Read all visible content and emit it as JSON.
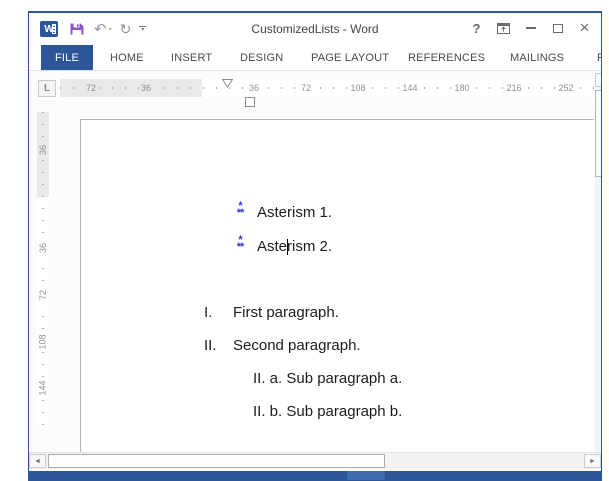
{
  "window": {
    "title": "CustomizedLists - Word",
    "controls": {
      "help_glyph": "?",
      "close_glyph": "×"
    }
  },
  "quick_access": {
    "word_logo_letter": "W",
    "undo_glyph": "↶",
    "undo_dropdown_glyph": "▾",
    "redo_glyph": "↻",
    "more_chevron_glyph": "▾"
  },
  "ribbon": {
    "tabs": [
      {
        "label": "FILE",
        "active": true
      },
      {
        "label": "HOME"
      },
      {
        "label": "INSERT"
      },
      {
        "label": "DESIGN"
      },
      {
        "label": "PAGE LAYOUT"
      },
      {
        "label": "REFERENCES"
      },
      {
        "label": "MAILINGS"
      },
      {
        "label": "REVIEW"
      }
    ]
  },
  "ruler": {
    "tab_selector": "L",
    "horizontal_numbers": [
      "72",
      "36",
      "36",
      "72",
      "108",
      "144",
      "180",
      "216",
      "252"
    ],
    "vertical_numbers": [
      "36",
      "36",
      "72",
      "108",
      "144"
    ]
  },
  "document": {
    "bullet_top": "*",
    "bullet_bottom": "**",
    "bullet1_text": "Asterism 1.",
    "bullet2_before_caret": "Aste",
    "bullet2_after_caret": "rism 2.",
    "roman1_number": "I.",
    "roman1_text": "First paragraph.",
    "roman2_number": "II.",
    "roman2_text": "Second paragraph.",
    "sub1_text": "II. a. Sub paragraph a.",
    "sub2_text": "II. b. Sub paragraph b."
  },
  "scrollbars": {
    "left_glyph": "◄",
    "right_glyph": "►"
  },
  "colors": {
    "accent_blue": "#2B579A",
    "save_purple": "#8C54C4",
    "asterism_blue": "#3333CC"
  }
}
